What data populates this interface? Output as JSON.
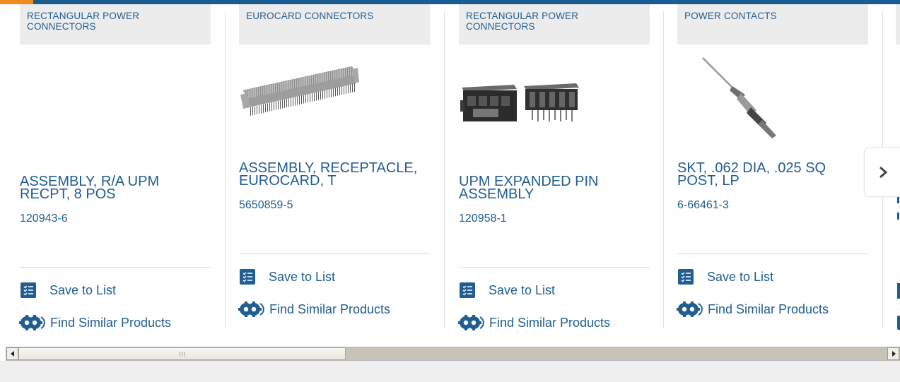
{
  "products": [
    {
      "category": "RECTANGULAR POWER CONNECTORS",
      "title": "ASSEMBLY, R/A UPM RECPT, 8 POS",
      "part_number": "120943-6",
      "image": "none"
    },
    {
      "category": "EUROCARD CONNECTORS",
      "title": "ASSEMBLY, RECEPTACLE, EUROCARD, T",
      "part_number": "5650859-5",
      "image": "eurocard-connector"
    },
    {
      "category": "RECTANGULAR POWER CONNECTORS",
      "title": "UPM EXPANDED PIN ASSEMBLY",
      "part_number": "120958-1",
      "image": "upm-connector-pair"
    },
    {
      "category": "POWER CONTACTS",
      "title": "SKT, .062 DIA, .025 SQ POST, LP",
      "part_number": "6-66461-3",
      "image": "socket-contact"
    }
  ],
  "actions": {
    "save_label": "Save to List",
    "similar_label": "Find Similar Products"
  },
  "icons": {
    "save": "checklist-icon",
    "similar": "gears-icon",
    "next": "chevron-right-icon"
  },
  "colors": {
    "brand_blue": "#1f5d93",
    "accent_orange": "#f28b1f",
    "top_bar": "#1a5c8f"
  }
}
